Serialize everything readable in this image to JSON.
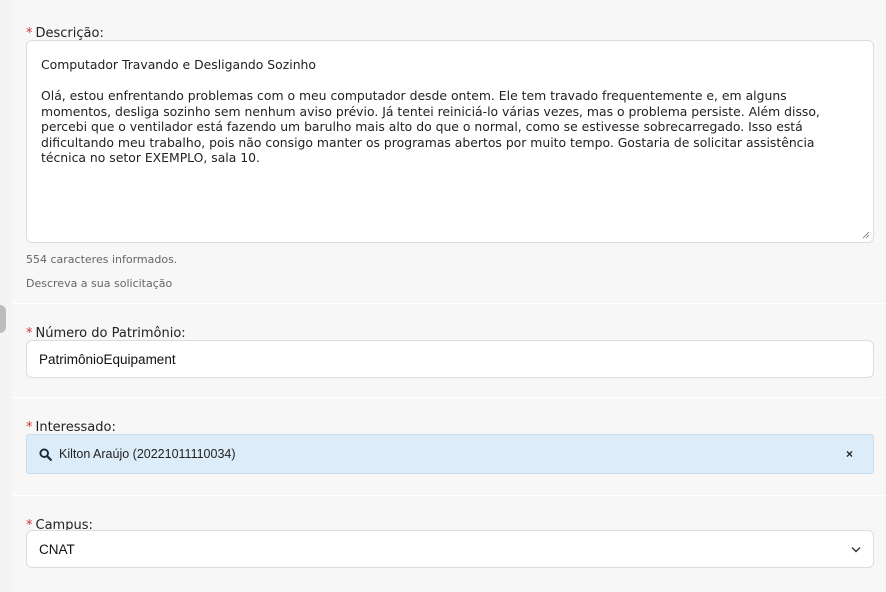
{
  "descricao": {
    "required_mark": "*",
    "label": "Descrição:",
    "text_title": "Computador Travando e Desligando Sozinho",
    "text_body": "Olá, estou enfrentando problemas com o meu computador desde ontem. Ele tem travado frequentemente e, em alguns momentos, desliga sozinho sem nenhum aviso prévio. Já tentei reiniciá-lo várias vezes, mas o problema persiste. Além disso, percebi que o ventilador está fazendo um barulho mais alto do que o normal, como se estivesse sobrecarregado. Isso está dificultando meu trabalho, pois não consigo manter os programas abertos por muito tempo. Gostaria de solicitar assistência técnica no setor EXEMPLO, sala 10.",
    "char_count": "554 caracteres informados.",
    "help_text": "Descreva a sua solicitação"
  },
  "patrimonio": {
    "required_mark": "*",
    "label": "Número do Patrimônio:",
    "value": "PatrimônioEquipament"
  },
  "interessado": {
    "required_mark": "*",
    "label": "Interessado:",
    "value": "Kilton Araújo (20221011110034)",
    "clear_label": "×",
    "icon": "search-icon"
  },
  "campus": {
    "required_mark": "*",
    "label": "Campus:",
    "selected": "CNAT",
    "icon": "chevron-down-icon"
  }
}
